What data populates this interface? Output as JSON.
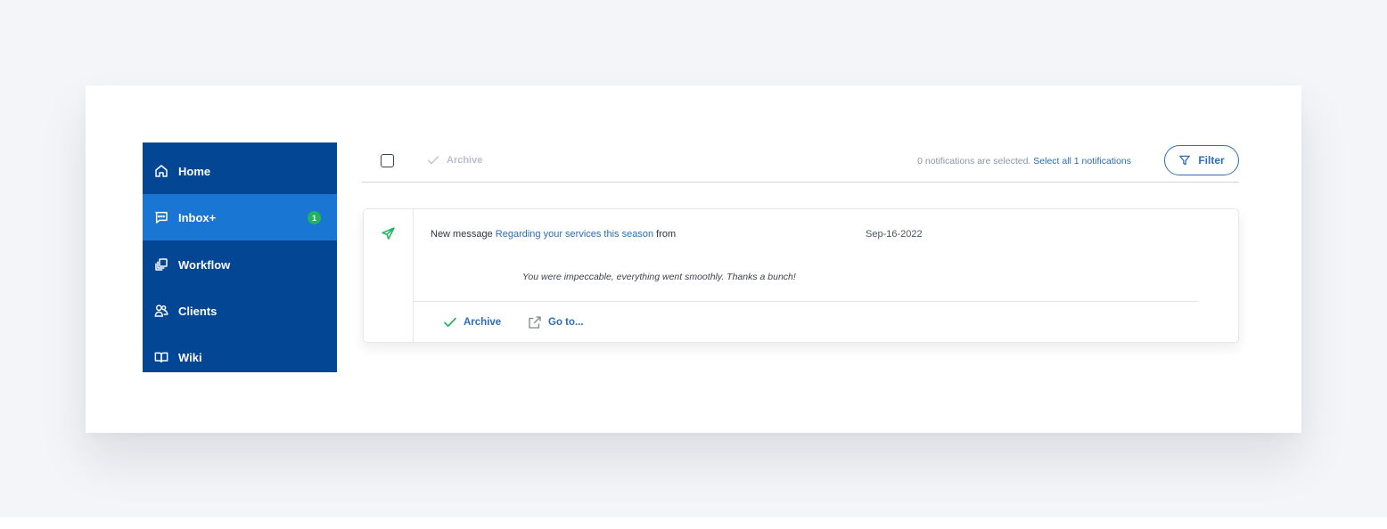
{
  "sidebar": {
    "items": [
      {
        "label": "Home",
        "icon": "home-icon"
      },
      {
        "label": "Inbox+",
        "icon": "message-square-icon",
        "badge": "1",
        "active": true
      },
      {
        "label": "Workflow",
        "icon": "copy-stack-icon"
      },
      {
        "label": "Clients",
        "icon": "users-icon"
      },
      {
        "label": "Wiki",
        "icon": "book-open-icon"
      }
    ]
  },
  "toolbar": {
    "archive_label": "Archive",
    "selection_text": "0 notifications are selected.",
    "select_all_link": "Select all 1 notifications",
    "filter_label": "Filter"
  },
  "notification": {
    "prefix": "New message",
    "subject_link": "Regarding your services this season",
    "suffix": "from",
    "date": "Sep-16-2022",
    "body": "You were impeccable, everything went smoothly. Thanks a bunch!",
    "actions": {
      "archive": "Archive",
      "goto": "Go to..."
    }
  },
  "colors": {
    "sidebar_bg": "#034694",
    "sidebar_active": "#1976d2",
    "accent_blue": "#2e6db4",
    "success_green": "#22b35e",
    "page_bg": "#f3f5f8"
  }
}
